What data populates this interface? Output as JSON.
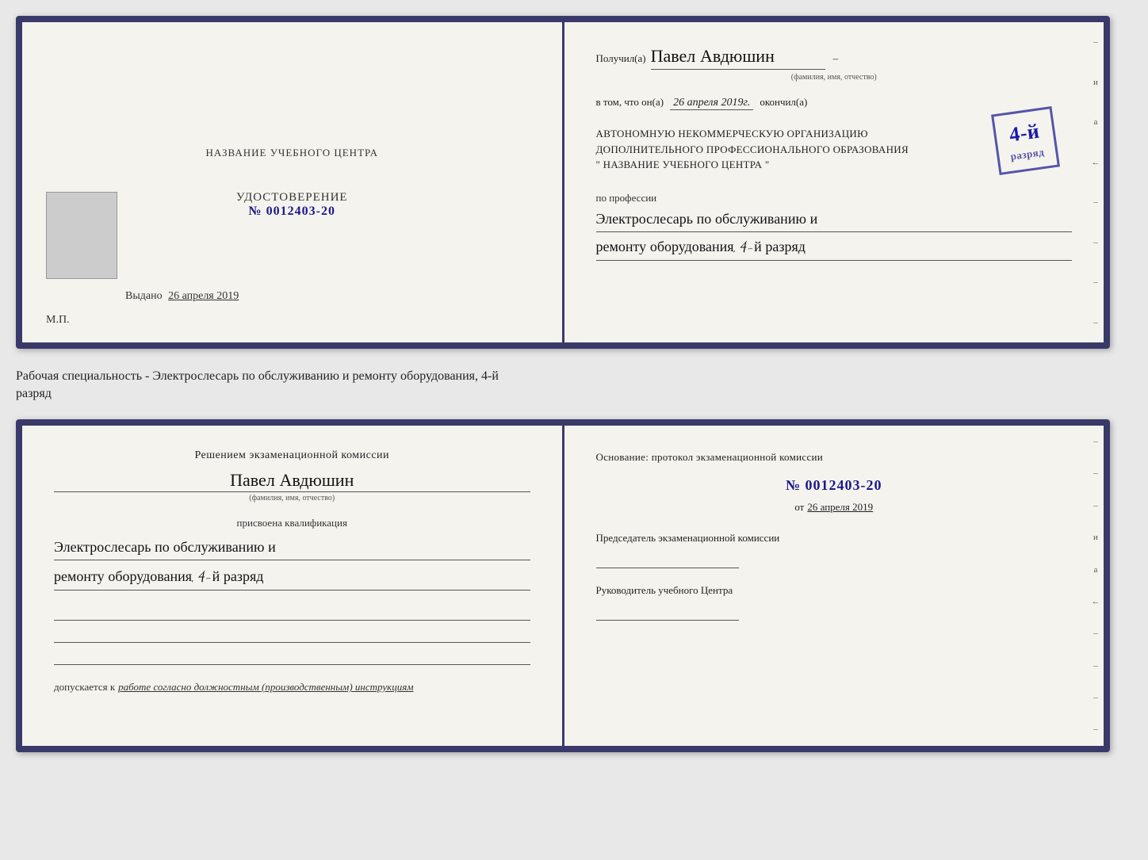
{
  "top_doc": {
    "left": {
      "center_title": "НАЗВАНИЕ УЧЕБНОГО ЦЕНТРА",
      "udostoverenie_label": "УДОСТОВЕРЕНИЕ",
      "udostoverenie_number": "№ 0012403-20",
      "vydano_label": "Выдано",
      "vydano_date": "26 апреля 2019",
      "mp_label": "М.П."
    },
    "right": {
      "poluchil_label": "Получил(а)",
      "name": "Павел Авдюшин",
      "fio_small": "(фамилия, имя, отчество)",
      "vtom_label": "в том, что он(а)",
      "date_italic": "26 апреля 2019г.",
      "okonchil_label": "окончил(а)",
      "stamp_number": "4-й",
      "stamp_line2": "разряд",
      "org_line1": "АВТОНОМНУЮ НЕКОММЕРЧЕСКУЮ ОРГАНИЗАЦИЮ",
      "org_line2": "ДОПОЛНИТЕЛЬНОГО ПРОФЕССИОНАЛЬНОГО ОБРАЗОВАНИЯ",
      "org_line3": "\" НАЗВАНИЕ УЧЕБНОГО ЦЕНТРА \"",
      "po_professii_label": "по профессии",
      "prof_line1": "Электрослесарь по обслуживанию и",
      "prof_line2": "ремонту оборудования, 4-й разряд",
      "dash": "–"
    }
  },
  "separator": {
    "text_line1": "Рабочая специальность - Электрослесарь по обслуживанию и ремонту оборудования, 4-й",
    "text_line2": "разряд"
  },
  "bottom_doc": {
    "left": {
      "resheniem_label": "Решением экзаменационной комиссии",
      "name": "Павел Авдюшин",
      "fio_small": "(фамилия, имя, отчество)",
      "prisvoena_label": "присвоена квалификация",
      "kvalif_line1": "Электрослесарь по обслуживанию и",
      "kvalif_line2": "ремонту оборудования, 4-й разряд",
      "dopusk_prefix": "допускается к",
      "dopusk_italic": "работе согласно должностным (производственным) инструкциям"
    },
    "right": {
      "osnovanie_label": "Основание: протокол экзаменационной комиссии",
      "protocol_number": "№ 0012403-20",
      "ot_label": "от",
      "ot_date": "26 апреля 2019",
      "predsedatel_label": "Председатель экзаменационной комиссии",
      "rukovoditel_label": "Руководитель учебного Центра"
    }
  },
  "binding_marks": [
    "–",
    "и",
    "а",
    "←",
    "–",
    "–",
    "–",
    "–"
  ]
}
